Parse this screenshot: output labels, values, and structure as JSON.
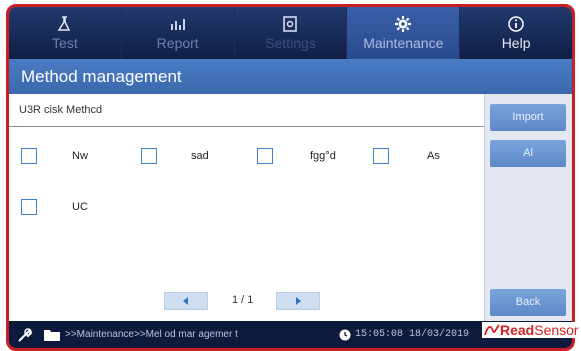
{
  "nav": {
    "tabs": [
      {
        "label": "Test",
        "icon": "flask-icon"
      },
      {
        "label": "Report",
        "icon": "chart-icon"
      },
      {
        "label": "Settings",
        "icon": "settings-doc-icon"
      },
      {
        "label": "Maintenance",
        "icon": "gear-icon"
      },
      {
        "label": "Help",
        "icon": "info-icon"
      }
    ]
  },
  "title": "Method management",
  "method_list": {
    "header": "U3R cisk Methcd",
    "items": [
      "Nw",
      "sad",
      "fgg°d",
      "As",
      "UC"
    ],
    "pager": {
      "text": "1 / 1"
    }
  },
  "side_buttons": {
    "import": "Import",
    "all": "Al",
    "back": "Back"
  },
  "status": {
    "breadcrumb": ">>Maintenance>>Mel od mar agemer t",
    "datetime": "15:05:08 18/03/2019",
    "brand_a": "Read",
    "brand_b": "Sensor"
  },
  "colors": {
    "accent": "#c81e24",
    "nav_bg": "#0f1f45",
    "title_bg": "#4a7cc4"
  }
}
